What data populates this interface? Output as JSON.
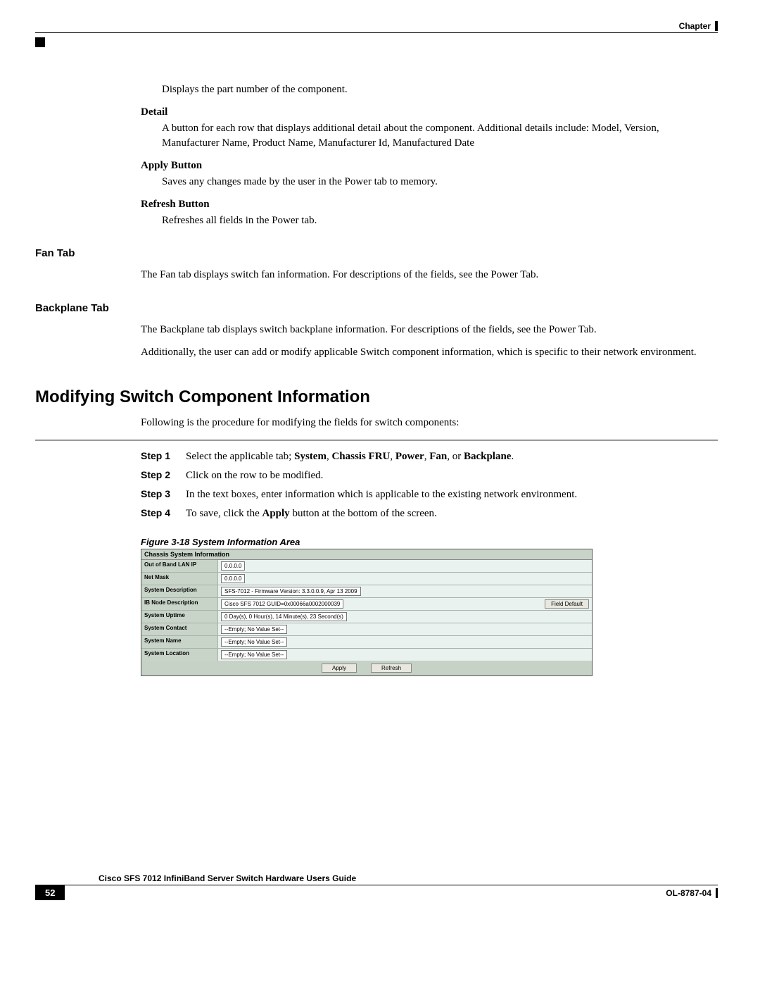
{
  "header": {
    "label": "Chapter"
  },
  "intro": {
    "part_number_desc": "Displays the part number of the component.",
    "detail_term": "Detail",
    "detail_body": "A button for each row that displays additional detail about the component. Additional details include: Model, Version, Manufacturer Name, Product Name, Manufacturer Id, Manufactured Date",
    "apply_term": "Apply Button",
    "apply_body": "Saves any changes made by the user in the Power tab to memory.",
    "refresh_term": "Refresh Button",
    "refresh_body": "Refreshes all fields in the Power tab."
  },
  "fan": {
    "label": "Fan Tab",
    "body": "The Fan tab displays switch fan information. For descriptions of the fields, see the Power Tab."
  },
  "backplane": {
    "label": "Backplane Tab",
    "body1": "The Backplane tab displays switch backplane information. For descriptions of the fields, see the Power Tab.",
    "body2": "Additionally, the user can add or modify applicable Switch component information, which is specific to their network environment."
  },
  "heading": "Modifying Switch Component Information",
  "heading_intro": "Following is the procedure for modifying the fields for switch components:",
  "steps": [
    {
      "num": "Step 1",
      "prefix": "Select the applicable tab; ",
      "bold_parts": [
        "System",
        "Chassis FRU",
        "Power",
        "Fan",
        "Backplane"
      ],
      "sep": ", ",
      "last_sep": ", or ",
      "suffix": "."
    },
    {
      "num": "Step 2",
      "text": "Click on the row to be modified."
    },
    {
      "num": "Step 3",
      "text": "In the text boxes, enter information which is applicable to the existing network environment."
    },
    {
      "num": "Step 4",
      "prefix": "To save, click the ",
      "bold_parts": [
        "Apply"
      ],
      "suffix": " button at the bottom of the screen."
    }
  ],
  "figure": {
    "caption": "Figure 3-18   System Information Area",
    "title": "Chassis System Information",
    "rows": [
      {
        "label": "Out of Band LAN IP",
        "value": "0.0.0.0"
      },
      {
        "label": "Net Mask",
        "value": "0.0.0.0"
      },
      {
        "label": "System Description",
        "value": "SFS-7012 - Firmware Version: 3.3.0.0.9, Apr 13 2009"
      },
      {
        "label": "IB Node Description",
        "value": "Cisco SFS 7012 GUID=0x00066a0002000039",
        "side_button": "Field Default"
      },
      {
        "label": "System Uptime",
        "value": "0 Day(s), 0 Hour(s), 14 Minute(s), 23 Second(s)"
      },
      {
        "label": "System Contact",
        "value": "--Empty; No Value Set--"
      },
      {
        "label": "System Name",
        "value": "--Empty; No Value Set--"
      },
      {
        "label": "System Location",
        "value": "--Empty; No Value Set--"
      }
    ],
    "buttons": {
      "apply": "Apply",
      "refresh": "Refresh"
    }
  },
  "footer": {
    "title": "Cisco SFS 7012 InfiniBand Server Switch Hardware Users Guide",
    "page": "52",
    "doc_id": "OL-8787-04"
  }
}
